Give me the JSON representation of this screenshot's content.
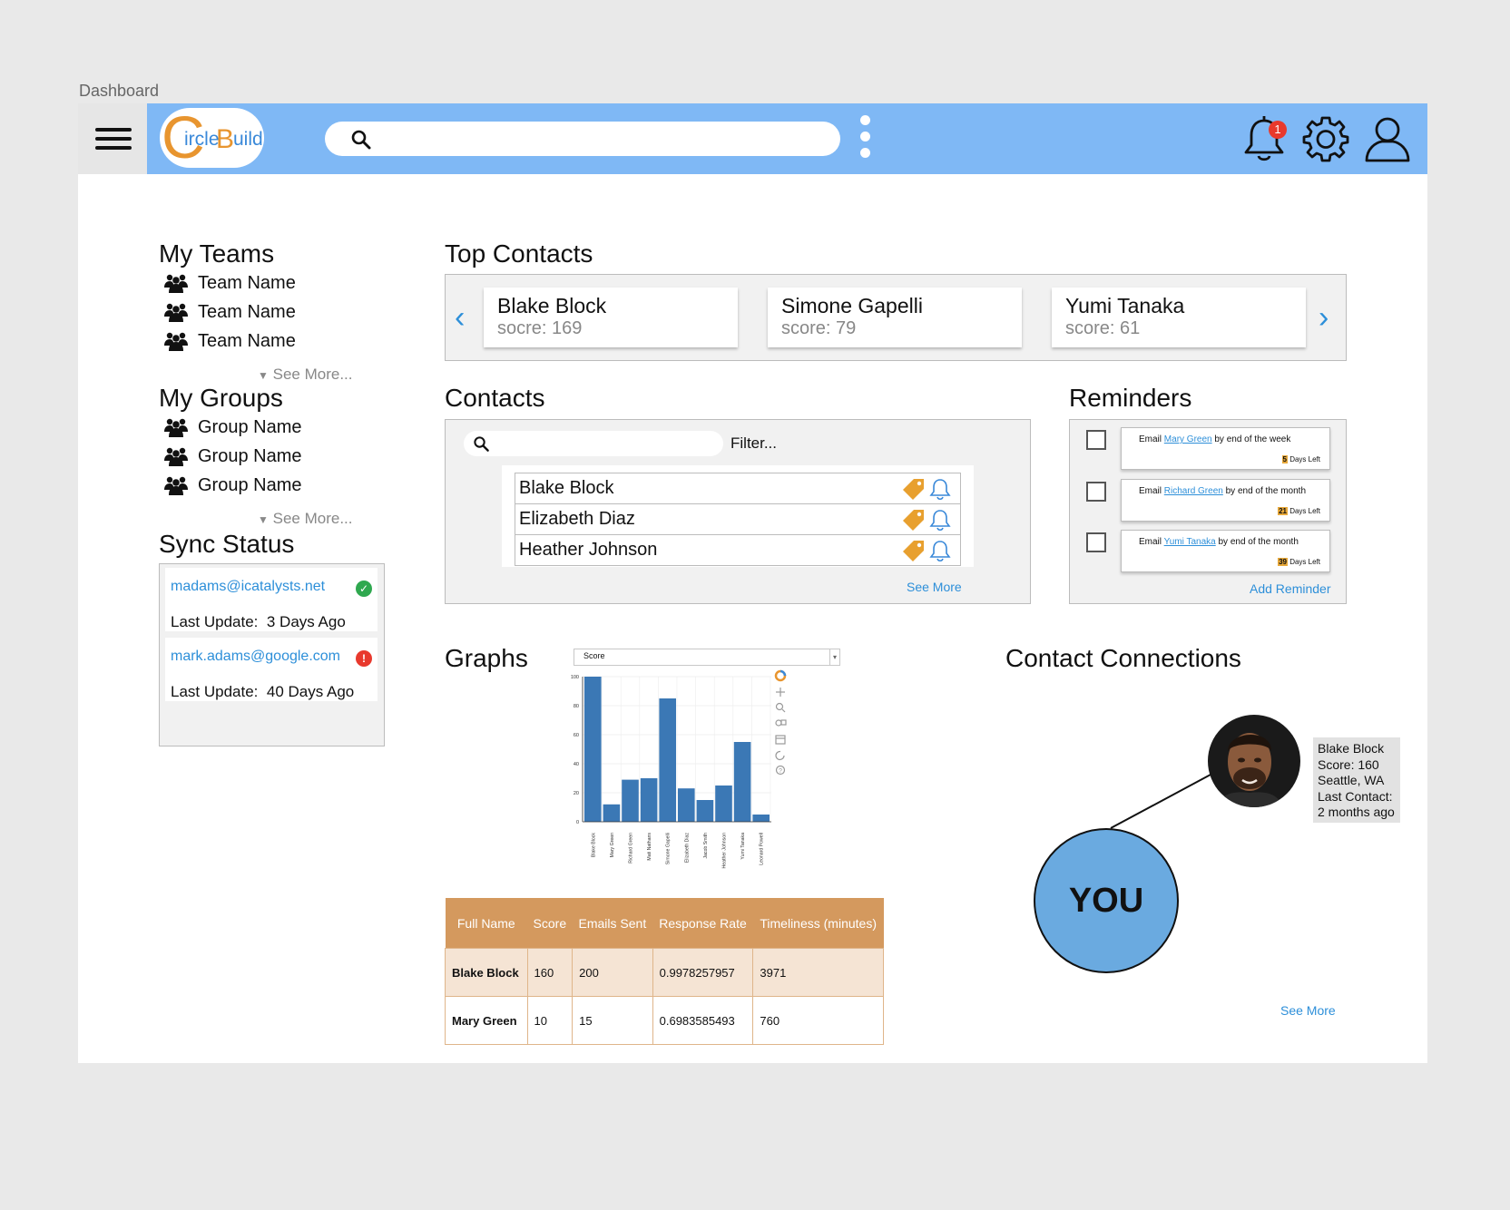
{
  "page_label": "Dashboard",
  "header": {
    "logo_c": "C",
    "logo_ircle": "ircle",
    "logo_b": "B",
    "logo_uild": "uild",
    "search_value": "",
    "notification_count": "1"
  },
  "sidebar": {
    "teams_title": "My Teams",
    "teams": [
      "Team Name",
      "Team Name",
      "Team Name"
    ],
    "teams_see_more": "See More...",
    "groups_title": "My Groups",
    "groups": [
      "Group Name",
      "Group Name",
      "Group Name"
    ],
    "groups_see_more": "See More...",
    "sync_title": "Sync Status",
    "sync": [
      {
        "email": "madams@icatalysts.net",
        "label": "Last Update:",
        "value": "3 Days Ago",
        "status": "ok",
        "status_glyph": "✓"
      },
      {
        "email": "mark.adams@google.com",
        "label": "Last Update:",
        "value": "40 Days Ago",
        "status": "error",
        "status_glyph": "!"
      }
    ]
  },
  "top_contacts": {
    "title": "Top Contacts",
    "cards": [
      {
        "name": "Blake Block",
        "score": "socre: 169"
      },
      {
        "name": "Simone Gapelli",
        "score": "score: 79"
      },
      {
        "name": "Yumi Tanaka",
        "score": "score: 61"
      }
    ]
  },
  "contacts": {
    "title": "Contacts",
    "search_value": "",
    "filter_label": "Filter...",
    "rows": [
      "Blake Block",
      "Elizabeth Diaz",
      "Heather Johnson"
    ],
    "see_more": "See More"
  },
  "reminders": {
    "title": "Reminders",
    "items": [
      {
        "prefix": "Email",
        "contact": "Mary Green",
        "suffix": "by end of the week",
        "days": "5",
        "days_label": "Days Left"
      },
      {
        "prefix": "Email",
        "contact": "Richard Green",
        "suffix": "by end of the month",
        "days": "21",
        "days_label": "Days Left"
      },
      {
        "prefix": "Email",
        "contact": "Yumi Tanaka",
        "suffix": "by end of the month",
        "days": "39",
        "days_label": "Days Left"
      }
    ],
    "add_label": "Add Reminder"
  },
  "graphs": {
    "title": "Graphs",
    "select_value": "Score"
  },
  "chart_data": {
    "type": "bar",
    "categories": [
      "Blake Block",
      "Mary Green",
      "Richard Green",
      "Mati Nathans",
      "Simone Gapelli",
      "Elizabeth Diaz",
      "Jacob Smith",
      "Heather Johnson",
      "Yumi Tanaka",
      "Leonard Powell"
    ],
    "values": [
      100,
      12,
      29,
      30,
      85,
      23,
      15,
      25,
      55,
      5
    ],
    "ylim": [
      0,
      100
    ],
    "yticks": [
      0,
      20,
      40,
      60,
      80,
      100
    ],
    "grid": true,
    "color": "#3b78b5"
  },
  "table": {
    "headers": [
      "Full Name",
      "Score",
      "Emails Sent",
      "Response Rate",
      "Timeliness (minutes)"
    ],
    "rows": [
      [
        "Blake Block",
        "160",
        "200",
        "0.9978257957",
        "3971"
      ],
      [
        "Mary Green",
        "10",
        "15",
        "0.6983585493",
        "760"
      ]
    ]
  },
  "connections": {
    "title": "Contact Connections",
    "you_label": "YOU",
    "person_lines": [
      "Blake Block",
      "Score: 160",
      "Seattle, WA",
      "Last Contact:",
      "2 months ago"
    ],
    "see_more": "See More"
  },
  "colors": {
    "accent_blue": "#7fb8f5",
    "link_blue": "#2d8fd9",
    "table_header": "#d4995e",
    "you_circle": "#6aaae0"
  }
}
